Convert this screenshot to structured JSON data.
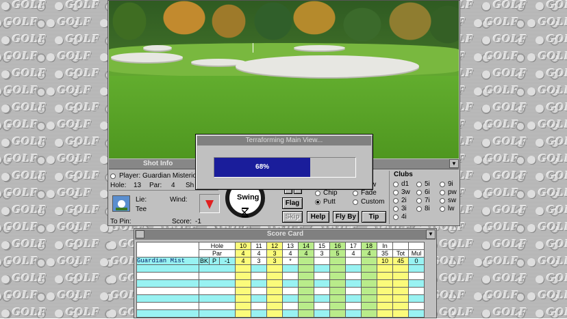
{
  "desktop": {
    "tile_text": "GOLF"
  },
  "progress": {
    "title": "Terraforming Main View...",
    "percent": 68,
    "label": "68%"
  },
  "shot_info": {
    "title": "Shot Info",
    "player_label": "Player:",
    "player_name": "Guardian Misterio",
    "hole_label": "Hole:",
    "hole_value": "13",
    "par_label": "Par:",
    "par_value": "4",
    "sh_label": "Sh",
    "lie_label": "Lie:",
    "lie_value": "Tee",
    "wind_label": "Wind:",
    "to_pin_label": "To Pin:",
    "score_label": "Score:",
    "score_value": "-1",
    "swing_label": "Swing",
    "buttons": {
      "flag": "Flag",
      "skip": "Skip",
      "help": "Help",
      "fly_by": "Fly By",
      "tip": "Tip"
    },
    "shot_types": [
      {
        "label": "Chip",
        "selected": false
      },
      {
        "label": "Putt",
        "selected": true
      }
    ],
    "shot_shapes": [
      {
        "label": "w"
      },
      {
        "label": "Fade"
      },
      {
        "label": "Custom"
      }
    ],
    "clubs_title": "Clubs",
    "clubs": [
      "d1",
      "5i",
      "9i",
      "3w",
      "6i",
      "pw",
      "2i",
      "7i",
      "sw",
      "3i",
      "8i",
      "lw",
      "4i"
    ]
  },
  "scorecard": {
    "title": "Score Card",
    "hole_label": "Hole",
    "par_label": "Par",
    "holes": [
      "10",
      "11",
      "12",
      "13",
      "14",
      "15",
      "16",
      "17",
      "18"
    ],
    "pars": [
      "4",
      "4",
      "3",
      "4",
      "4",
      "3",
      "5",
      "4",
      "4"
    ],
    "in_label": "In",
    "in_par": "35",
    "tot_label": "Tot",
    "mul_label": "Mul",
    "player": {
      "name": "Guardian Mist",
      "tee": "BK",
      "flag": "P",
      "score_to_par": "-1",
      "scores": [
        "4",
        "3",
        "3",
        "*",
        "",
        "",
        "",
        "",
        ""
      ],
      "in": "10",
      "tot": "45",
      "mul": "0"
    }
  }
}
